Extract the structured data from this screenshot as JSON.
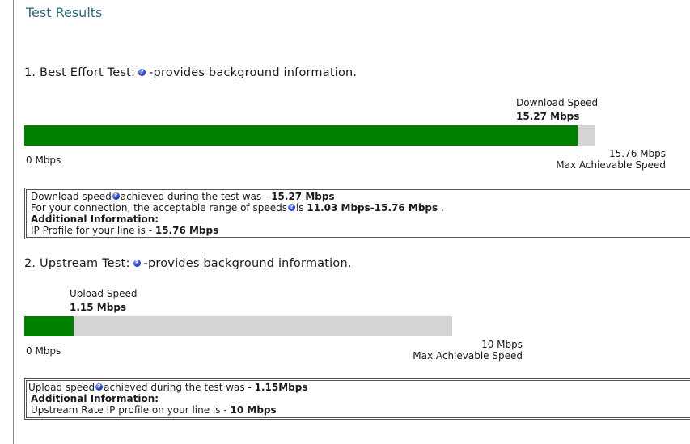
{
  "page": {
    "title": "Test Results"
  },
  "best_effort": {
    "heading_prefix": "1. Best Effort Test:",
    "heading_suffix": "-provides background information.",
    "speed_caption": "Download Speed",
    "speed_value": "15.27 Mbps",
    "fraction": 0.9689,
    "min_label": "0 Mbps",
    "max_value": "15.76 Mbps",
    "max_caption": "Max Achievable Speed",
    "info": {
      "line1_a": "Download speed",
      "line1_b": "achieved during the test was -",
      "line1_val": "15.27 Mbps",
      "line2_a": "For your connection, the acceptable range of speeds",
      "line2_b": "is",
      "line2_val": "11.03 Mbps-15.76 Mbps",
      "line2_end": ".",
      "additional": "Additional Information:",
      "line4_a": "IP Profile for your line is -",
      "line4_val": "15.76 Mbps"
    }
  },
  "upstream": {
    "heading_prefix": "2. Upstream Test:",
    "heading_suffix": "-provides background information.",
    "speed_caption": "Upload Speed",
    "speed_value": "1.15 Mbps",
    "fraction": 0.115,
    "min_label": "0 Mbps",
    "max_value": "10 Mbps",
    "max_caption": "Max Achievable Speed",
    "info": {
      "line1_a": "Upload speed",
      "line1_b": "achieved during the test was -",
      "line1_val": "1.15Mbps",
      "additional": "Additional Information:",
      "line3_a": "Upstream Rate IP profile on your line is -",
      "line3_val": "10 Mbps"
    }
  },
  "colors": {
    "bar_fill": "#008000",
    "bar_track": "#d4d4d4",
    "title": "#2f6a73"
  },
  "icons": {
    "help": "question-mark-help-icon"
  }
}
